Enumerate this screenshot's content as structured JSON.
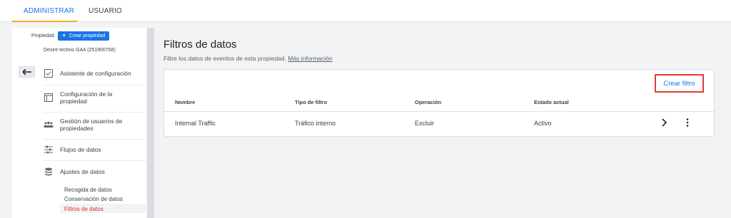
{
  "tabs": {
    "admin": "ADMINISTRAR",
    "user": "USUARIO"
  },
  "property": {
    "label": "Propiedad",
    "create_button": "Crear propiedad",
    "name": "Desire techno GA4 (251900758)"
  },
  "nav": {
    "items": [
      {
        "label": "Asistente de configuración",
        "icon": "checkbox-icon"
      },
      {
        "label": "Configuración de la propiedad",
        "icon": "window-icon"
      },
      {
        "label": "Gestión de usuarios de propiedades",
        "icon": "people-icon"
      },
      {
        "label": "Flujos de datos",
        "icon": "streams-icon"
      },
      {
        "label": "Ajustes de datos",
        "icon": "database-icon"
      }
    ],
    "sub_items": [
      {
        "label": "Recogida de datos"
      },
      {
        "label": "Conservación de datos"
      },
      {
        "label": "Filtros de datos",
        "active": true
      }
    ]
  },
  "main": {
    "title": "Filtros de datos",
    "description": "Filtre los datos de eventos de esta propiedad.",
    "learn_more": "Más información",
    "create_filter_button": "Crear filtro",
    "table": {
      "headers": {
        "name": "Nombre",
        "type": "Tipo de filtro",
        "operation": "Operación",
        "state": "Estado actual"
      },
      "rows": [
        {
          "name": "Internal Traffic",
          "type": "Tráfico interno",
          "operation": "Excluir",
          "state": "Activo"
        }
      ]
    }
  },
  "colors": {
    "accent": "#1a73e8",
    "tab_underline": "#f6a623",
    "active_red": "#d93025",
    "highlight_border": "#e53935"
  }
}
